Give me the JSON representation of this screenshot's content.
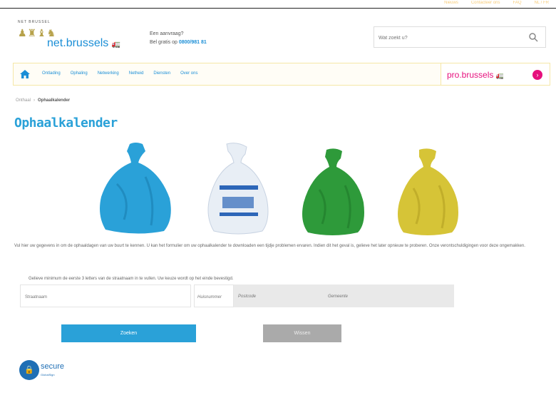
{
  "topbar": {
    "links": [
      "Nieuws",
      "Contacteer ons",
      "FAQ",
      "NL / FR"
    ]
  },
  "logo": {
    "small_text": "NET BRUSSEL",
    "brand": "net.brussels"
  },
  "hotline": {
    "line1": "Een aanvraag?",
    "line2_prefix": "Bel gratis op",
    "number": "0800/981 81"
  },
  "search": {
    "placeholder": "Wat zoekt u?"
  },
  "nav": {
    "items": [
      "Ontlading",
      "Ophaling",
      "Netwerking",
      "Netheid",
      "Diensten",
      "Over ons"
    ]
  },
  "pro": {
    "label": "pro.brussels",
    "arrow": "›"
  },
  "breadcrumb": {
    "home": "Onthaal",
    "separator": "›",
    "current": "Ophaalkalender"
  },
  "page_title": "Ophaalkalender",
  "bags": [
    {
      "name": "blue",
      "color": "#2aa1d8"
    },
    {
      "name": "white",
      "color": "#e8eef5"
    },
    {
      "name": "green",
      "color": "#2e9a3a"
    },
    {
      "name": "yellow",
      "color": "#d6c437"
    }
  ],
  "intro": "Vul hier uw gegevens in om de ophaaldagen van uw buurt te kennen. U kan het formulier om uw ophaalkalender te downloaden een tijdje problemen ervaren. Indien dit het geval is, gelieve het later opnieuw te proberen. Onze verontschuldigingen voor deze ongemakken.",
  "form": {
    "note": "Gelieve minimum de eerste 3 letters van de straatnaam in te vullen. Uw keuze wordt op het einde bevestigd.",
    "street_label": "Straatnaam",
    "number_label": "Huisnummer",
    "postcode_label": "Postcode",
    "municipality_label": "Gemeente"
  },
  "buttons": {
    "search": "Zoeken",
    "clear": "Wissen"
  },
  "secure": {
    "title": "secure",
    "subtitle": "GlobalSign",
    "icon": "lock-icon"
  }
}
